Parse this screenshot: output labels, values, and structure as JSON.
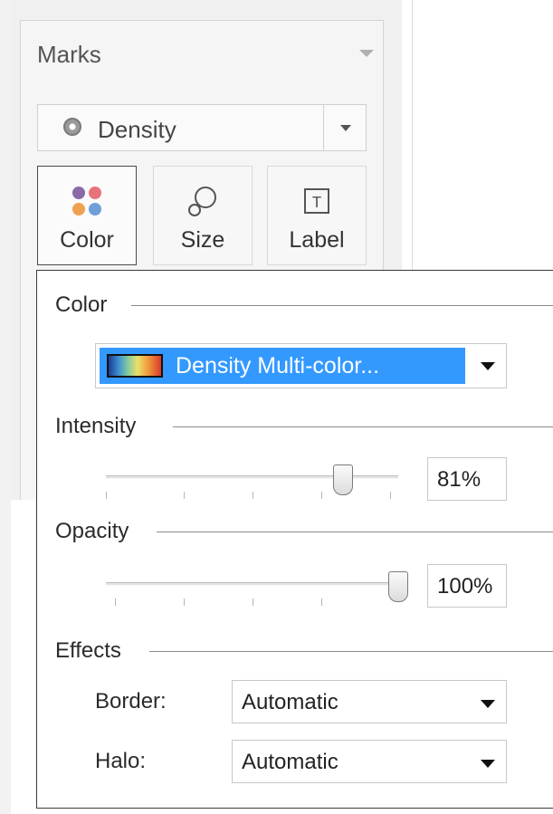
{
  "marks": {
    "title": "Marks",
    "mark_type": "Density",
    "shelves": [
      {
        "label": "Color",
        "icon": "color-dots-icon"
      },
      {
        "label": "Size",
        "icon": "size-icon"
      },
      {
        "label": "Label",
        "icon": "label-text-icon",
        "icon_glyph": "T"
      }
    ]
  },
  "popup": {
    "color": {
      "heading": "Color",
      "palette": "Density Multi-color..."
    },
    "intensity": {
      "heading": "Intensity",
      "value": "81%",
      "level": 0.81
    },
    "opacity": {
      "heading": "Opacity",
      "value": "100%",
      "level": 1.0
    },
    "effects": {
      "heading": "Effects",
      "border_label": "Border:",
      "border_value": "Automatic",
      "halo_label": "Halo:",
      "halo_value": "Automatic"
    }
  },
  "colors": {
    "selection_blue": "#3399ff",
    "color_icon_dots": [
      "#8b6aa8",
      "#e8727a",
      "#f0a150",
      "#6f9fd8"
    ]
  }
}
